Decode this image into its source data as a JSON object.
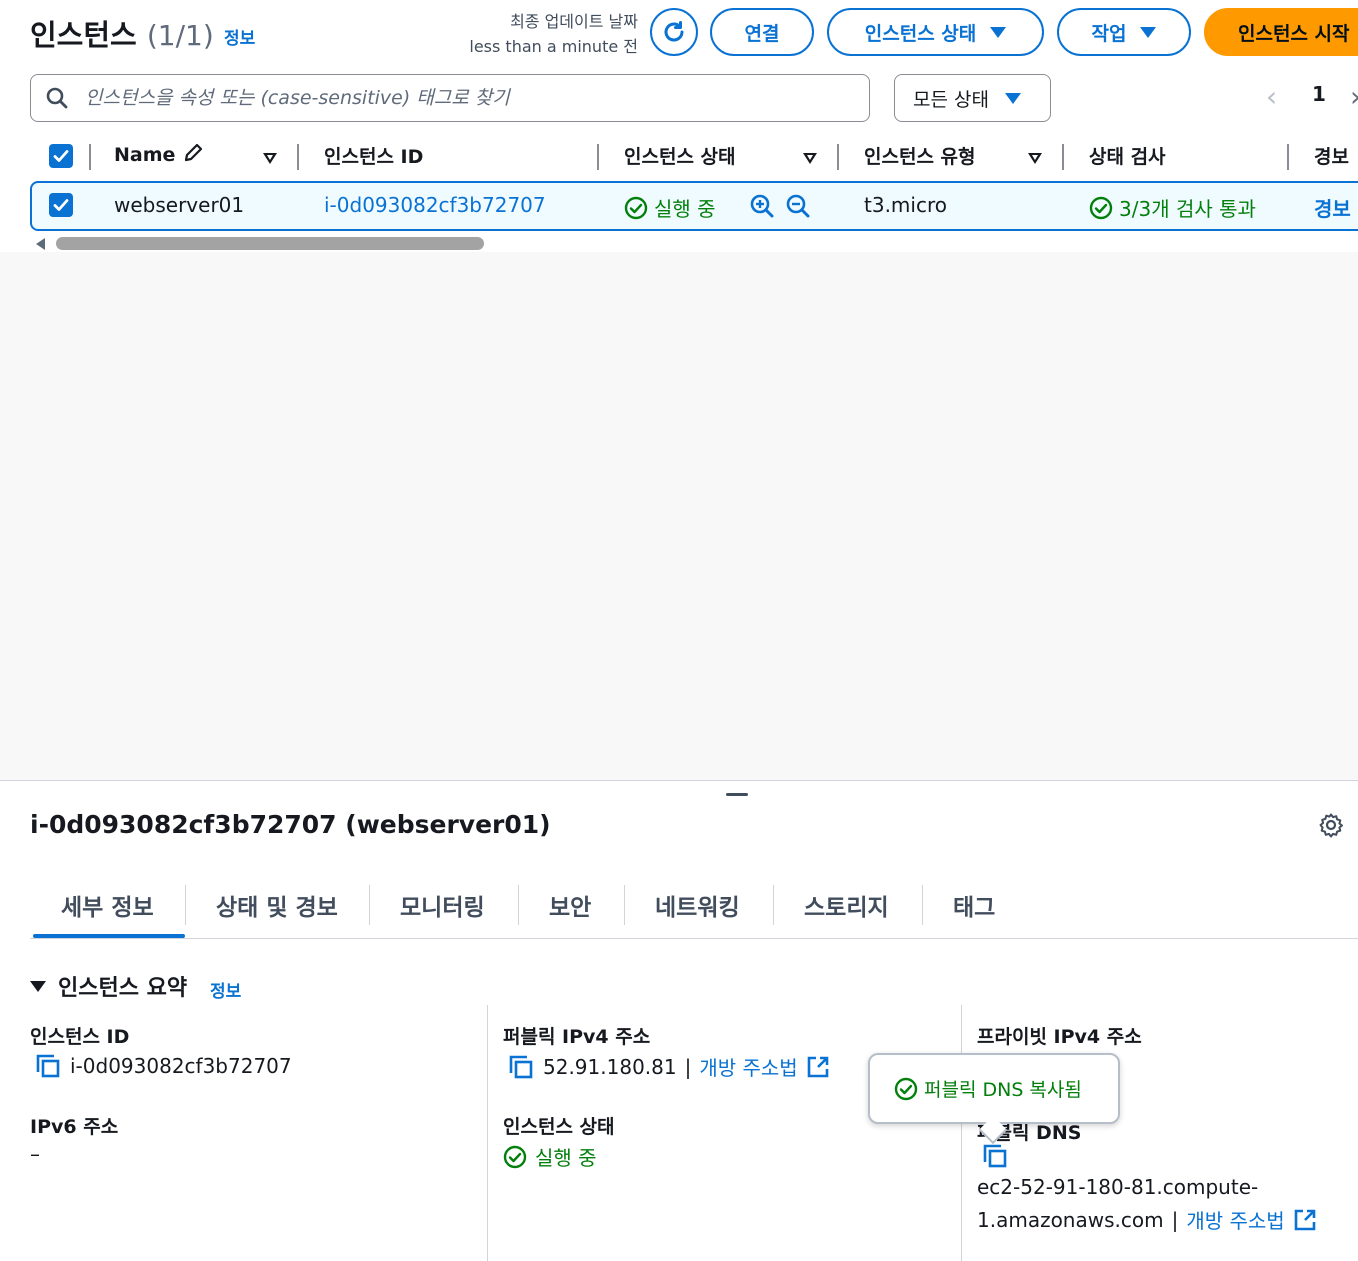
{
  "header": {
    "title": "인스턴스",
    "count": "(1/1)",
    "info": "정보",
    "last_updated_label": "최종 업데이트 날짜",
    "last_updated_value": "less than a minute 전",
    "connect": "연결",
    "instance_state": "인스턴스 상태",
    "actions": "작업",
    "launch": "인스턴스 시작"
  },
  "search": {
    "placeholder": "인스턴스을 속성 또는 (case-sensitive) 태그로 찾기"
  },
  "state_filter": "모든 상태",
  "pagination": {
    "page": "1"
  },
  "table": {
    "columns": [
      "Name",
      "인스턴스 ID",
      "인스턴스 상태",
      "인스턴스 유형",
      "상태 검사",
      "경보"
    ],
    "rows": [
      {
        "name": "webserver01",
        "instance_id": "i-0d093082cf3b72707",
        "state": "실행 중",
        "type": "t3.micro",
        "status_check": "3/3개 검사 통과",
        "alarm": "경보"
      }
    ]
  },
  "detail": {
    "title": "i-0d093082cf3b72707 (webserver01)",
    "tabs": [
      "세부 정보",
      "상태 및 경보",
      "모니터링",
      "보안",
      "네트워킹",
      "스토리지",
      "태그"
    ],
    "active_tab": "세부 정보",
    "summary_title": "인스턴스 요약",
    "info": "정보",
    "instance_id_label": "인스턴스 ID",
    "instance_id": "i-0d093082cf3b72707",
    "ipv6_label": "IPv6 주소",
    "ipv6_value": "–",
    "public_ipv4_label": "퍼블릭 IPv4 주소",
    "public_ipv4": "52.91.180.81",
    "separator": "|",
    "open_address": "개방 주소법",
    "state_label": "인스턴스 상태",
    "state_value": "실행 중",
    "private_ipv4_label": "프라이빗 IPv4 주소",
    "public_dns_label_partial": "퍼블릭 DNS",
    "public_dns_line1": "ec2-52-91-180-81.compute-",
    "public_dns_line2": "1.amazonaws.com"
  },
  "popover": {
    "message": "퍼블릭 DNS 복사됨"
  },
  "colors": {
    "accent": "#0972d3",
    "primary_button": "#ff9900",
    "success": "#037f0c"
  }
}
